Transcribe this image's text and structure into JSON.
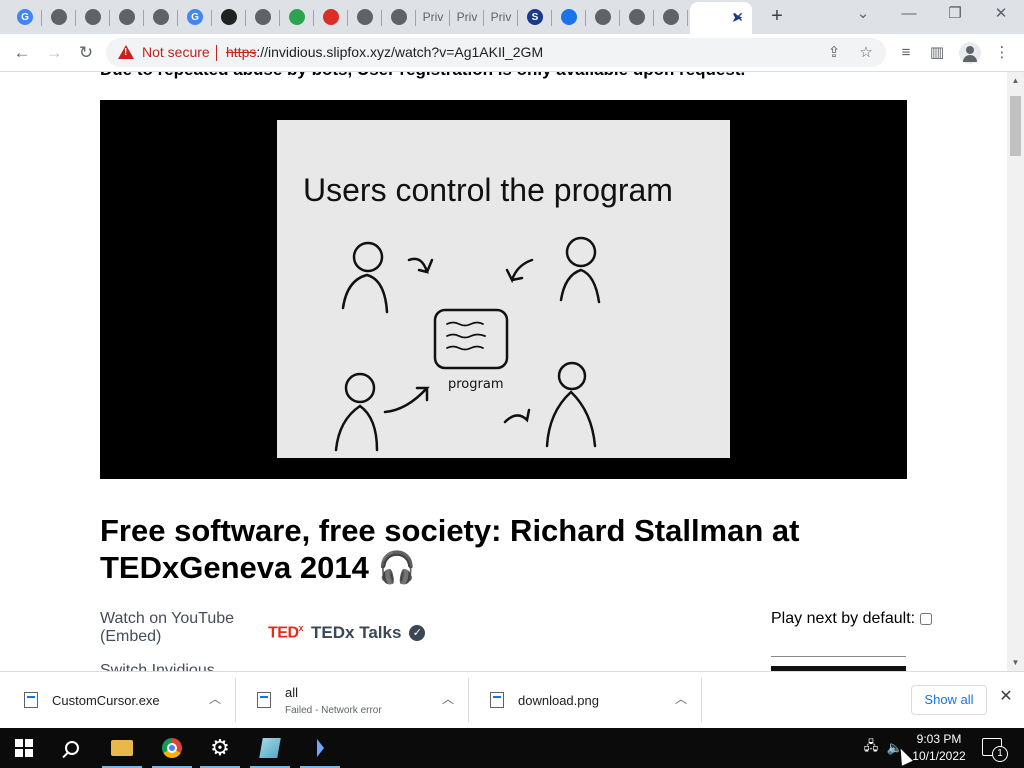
{
  "browser": {
    "tabs": [
      {
        "icon": "google-icon",
        "letter": "G",
        "color": "#4285f4"
      },
      {
        "icon": "globe-icon",
        "letter": "",
        "color": "#5f6368"
      },
      {
        "icon": "globe-icon",
        "letter": "",
        "color": "#5f6368"
      },
      {
        "icon": "globe-icon",
        "letter": "",
        "color": "#5f6368"
      },
      {
        "icon": "globe-icon",
        "letter": "",
        "color": "#5f6368"
      },
      {
        "icon": "google-icon",
        "letter": "G",
        "color": "#4285f4"
      },
      {
        "icon": "shield-icon",
        "letter": "",
        "color": "#222222"
      },
      {
        "icon": "globe-icon",
        "letter": "",
        "color": "#5f6368"
      },
      {
        "icon": "arrows-icon",
        "letter": "",
        "color": "#2da44e"
      },
      {
        "icon": "blocked-icon",
        "letter": "",
        "color": "#d93025"
      },
      {
        "icon": "globe-icon",
        "letter": "",
        "color": "#5f6368"
      },
      {
        "icon": "globe-icon",
        "letter": "",
        "color": "#5f6368"
      },
      {
        "icon": "text-tab",
        "letter": "Priv",
        "color": "#5f6368"
      },
      {
        "icon": "text-tab",
        "letter": "Priv",
        "color": "#5f6368"
      },
      {
        "icon": "text-tab",
        "letter": "Priv",
        "color": "#5f6368"
      },
      {
        "icon": "s-icon",
        "letter": "S",
        "color": "#1a3a8c"
      },
      {
        "icon": "cloud-download-icon",
        "letter": "",
        "color": "#1a73e8"
      },
      {
        "icon": "globe-icon",
        "letter": "",
        "color": "#5f6368"
      },
      {
        "icon": "globe-icon",
        "letter": "",
        "color": "#5f6368"
      },
      {
        "icon": "globe-icon",
        "letter": "",
        "color": "#5f6368"
      }
    ],
    "security_label": "Not secure",
    "url_scheme": "https",
    "url_rest": "://invidious.slipfox.xyz/watch?v=Ag1AKIl_2GM"
  },
  "page": {
    "notice": "Due to repeated abuse by bots, User registration is only available upon request.",
    "slide_title": "Users control the program",
    "slide_caption": "program",
    "video_title": "Free software, free society: Richard Stallman at TEDxGeneva 2014",
    "watch_link": "Watch on YouTube",
    "embed_link": "(Embed)",
    "channel_logo": "TED",
    "channel_logo_sup": "x",
    "channel_name": "TEDx Talks",
    "playnext_label": "Play next by default:",
    "switch_text": "Switch Invidious"
  },
  "downloads": [
    {
      "name": "CustomCursor.exe",
      "status": ""
    },
    {
      "name": "all",
      "status": "Failed - Network error"
    },
    {
      "name": "download.png",
      "status": ""
    }
  ],
  "downloads_show_all": "Show all",
  "taskbar": {
    "time": "9:03 PM",
    "date": "10/1/2022",
    "notification_count": "1"
  }
}
